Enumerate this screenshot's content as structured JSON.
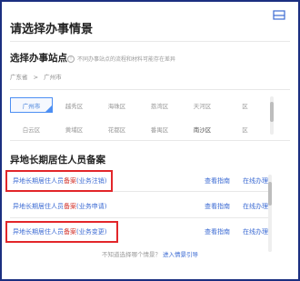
{
  "header": {
    "title": "请选择办事情景",
    "icon": "box-icon"
  },
  "station": {
    "title": "选择办事站点",
    "note": "不同办事站点的流程和材料可能存在差异",
    "breadcrumb": [
      "广东省",
      "广州市"
    ],
    "districts": [
      {
        "label": "广州市",
        "active": true
      },
      {
        "label": "越秀区"
      },
      {
        "label": "海珠区"
      },
      {
        "label": "荔湾区"
      },
      {
        "label": "天河区"
      },
      {
        "label": "区"
      },
      {
        "label": "白云区"
      },
      {
        "label": "黄埔区"
      },
      {
        "label": "花都区"
      },
      {
        "label": "番禺区"
      },
      {
        "label": "南沙区",
        "dark": true
      },
      {
        "label": "区"
      }
    ]
  },
  "record": {
    "title": "异地长期居住人员备案",
    "items": [
      {
        "prefix": "异地长期居住人员",
        "hl": "备案",
        "suffix": "(业务注销)",
        "guide": "查看指南",
        "apply": "在线办理"
      },
      {
        "prefix": "异地长期居住人员",
        "hl": "备案",
        "suffix": "(业务申请)",
        "guide": "查看指南",
        "apply": "在线办理"
      },
      {
        "prefix": "异地长期居住人员",
        "hl": "备案",
        "suffix": "(业务变更)",
        "guide": "查看指南",
        "apply": "在线办理"
      }
    ]
  },
  "footer": {
    "question": "不知道选择哪个情景？",
    "link": "进入情景引导"
  },
  "colors": {
    "frame": "#1b2f80",
    "accent": "#3c6bd3",
    "highlight": "#e2262a"
  }
}
